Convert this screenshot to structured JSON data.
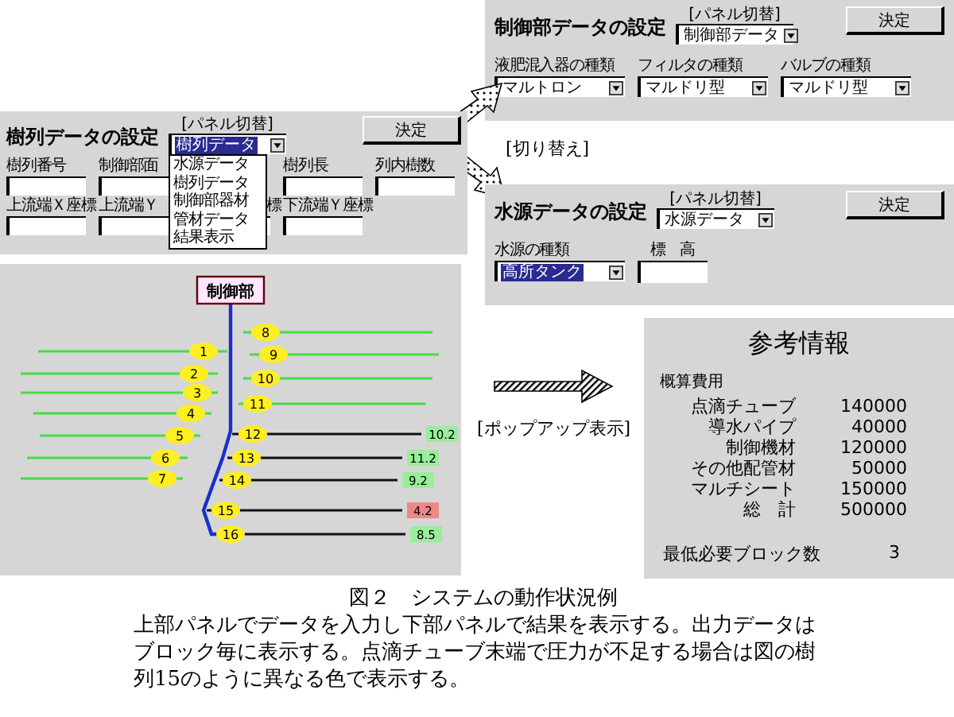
{
  "control_panel": {
    "title": "制御部データの設定",
    "switch_label": "[パネル切替]",
    "switch_value": "制御部データ",
    "switch_highlighted": false,
    "ok_button": "決定",
    "selects": [
      {
        "label": "液肥混入器の種類",
        "value": "マルトロン"
      },
      {
        "label": "フィルタの種類",
        "value": "マルドリ型"
      },
      {
        "label": "バルブの種類",
        "value": "マルドリ型"
      }
    ]
  },
  "switch_note": "[切り替え]",
  "row_panel": {
    "title": "樹列データの設定",
    "switch_label": "[パネル切替]",
    "switch_value": "樹列データ",
    "switch_highlighted": true,
    "ok_button": "決定",
    "dropdown_options": [
      "水源データ",
      "樹列データ",
      "制御部器材",
      "管材データ",
      "結果表示"
    ],
    "field_rows": [
      [
        {
          "label": "樹列番号"
        },
        {
          "label": "制御部面"
        },
        null,
        {
          "label": "樹列長"
        },
        {
          "label": "列内樹数"
        }
      ],
      [
        {
          "label": "上流端Ｘ座標"
        },
        {
          "label": "上流端Ｙ"
        },
        {
          "label": "標"
        },
        {
          "label": "下流端Ｙ座標"
        },
        null
      ]
    ]
  },
  "water_panel": {
    "title": "水源データの設定",
    "switch_label": "[パネル切替]",
    "switch_value": "水源データ",
    "switch_highlighted": false,
    "ok_button": "決定",
    "source_label": "水源の種類",
    "source_value": "高所タンク",
    "source_highlighted": true,
    "elevation_label": "標　高"
  },
  "tree": {
    "control_label": "制御部",
    "branches": [
      {
        "number": "1"
      },
      {
        "number": "2"
      },
      {
        "number": "3"
      },
      {
        "number": "4"
      },
      {
        "number": "5"
      },
      {
        "number": "6"
      },
      {
        "number": "7"
      },
      {
        "number": "8"
      },
      {
        "number": "9"
      },
      {
        "number": "10"
      },
      {
        "number": "11"
      },
      {
        "number": "12",
        "result": {
          "value": "10.2",
          "color": "#99ee99"
        }
      },
      {
        "number": "13",
        "result": {
          "value": "11.2",
          "color": "#99ee99"
        }
      },
      {
        "number": "14",
        "result": {
          "value": "9.2",
          "color": "#99ee99"
        }
      },
      {
        "number": "15",
        "result": {
          "value": "4.2",
          "color": "#ee8888"
        }
      },
      {
        "number": "16",
        "result": {
          "value": "8.5",
          "color": "#99ee99"
        }
      }
    ]
  },
  "popup_note": "[ポップアップ表示]",
  "info_panel": {
    "title": "参考情報",
    "section": "概算費用",
    "costs": [
      {
        "label": "点滴チューブ",
        "value": "140000"
      },
      {
        "label": "導水パイプ",
        "value": "40000"
      },
      {
        "label": "制御機材",
        "value": "120000"
      },
      {
        "label": "その他配管材",
        "value": "50000"
      },
      {
        "label": "マルチシート",
        "value": "150000"
      },
      {
        "label": "総　計",
        "value": "500000"
      }
    ],
    "min_blocks_label": "最低必要ブロック数",
    "min_blocks_value": "3"
  },
  "caption": {
    "title": "図２　システムの動作状況例",
    "body": "上部パネルでデータを入力し下部パネルで結果を表示する。出力データはブロック毎に表示する。点滴チューブ末端で圧力が不足する場合は図の樹列15のように異なる色で表示する。"
  }
}
